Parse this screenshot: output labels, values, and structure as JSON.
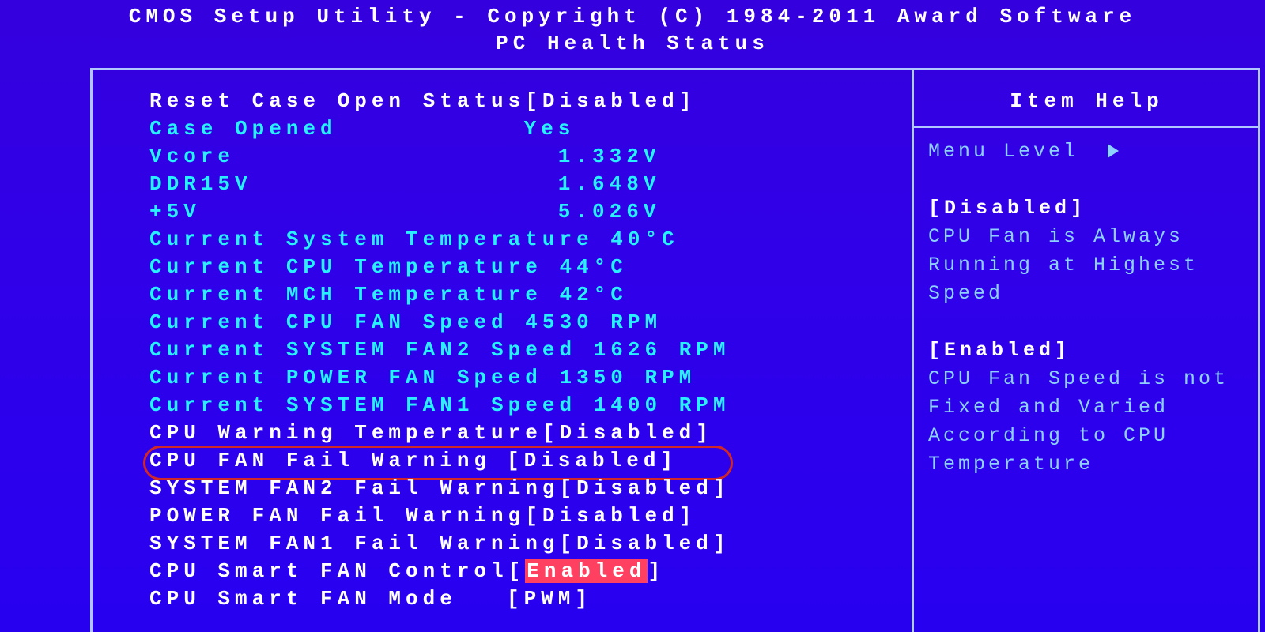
{
  "header": {
    "title": "CMOS Setup Utility - Copyright (C) 1984-2011 Award Software",
    "subtitle": "PC Health Status"
  },
  "rows": [
    {
      "label": "Reset Case Open Status",
      "value": "[Disabled]",
      "style": "white",
      "interactable": true
    },
    {
      "label": "Case Opened",
      "value": " Yes",
      "style": "cyan",
      "interactable": false
    },
    {
      "label": "Vcore",
      "value": "   1.332V",
      "style": "cyan",
      "interactable": false
    },
    {
      "label": "DDR15V",
      "value": "   1.648V",
      "style": "cyan",
      "interactable": false
    },
    {
      "label": "+5V",
      "value": "   5.026V",
      "style": "cyan",
      "interactable": false
    },
    {
      "label": "Current System Temperature",
      "value": " 40°C",
      "style": "cyan",
      "interactable": false
    },
    {
      "label": "Current CPU Temperature",
      "value": " 44°C",
      "style": "cyan",
      "interactable": false
    },
    {
      "label": "Current MCH Temperature",
      "value": " 42°C",
      "style": "cyan",
      "interactable": false
    },
    {
      "label": "Current CPU FAN Speed",
      "value": " 4530 RPM",
      "style": "cyan",
      "interactable": false
    },
    {
      "label": "Current SYSTEM FAN2 Speed",
      "value": " 1626 RPM",
      "style": "cyan",
      "interactable": false
    },
    {
      "label": "Current POWER FAN Speed",
      "value": " 1350 RPM",
      "style": "cyan",
      "interactable": false
    },
    {
      "label": "Current SYSTEM FAN1 Speed",
      "value": " 1400 RPM",
      "style": "cyan",
      "interactable": false
    },
    {
      "label": "CPU Warning Temperature",
      "value": "[Disabled]",
      "style": "white",
      "interactable": true
    },
    {
      "label": "CPU FAN Fail Warning",
      "value": "[Disabled]",
      "style": "white",
      "interactable": true,
      "circled": true
    },
    {
      "label": "SYSTEM FAN2 Fail Warning",
      "value": "[Disabled]",
      "style": "white",
      "interactable": true
    },
    {
      "label": "POWER FAN Fail Warning",
      "value": "[Disabled]",
      "style": "white",
      "interactable": true
    },
    {
      "label": "SYSTEM FAN1 Fail Warning",
      "value": "[Disabled]",
      "style": "white",
      "interactable": true
    },
    {
      "label": "CPU Smart FAN Control",
      "value_open": "[",
      "value_sel": "Enabled",
      "value_close": "]",
      "style": "white",
      "interactable": true,
      "selected": true
    },
    {
      "label": "CPU Smart FAN Mode",
      "value": "[PWM]",
      "style": "white",
      "interactable": true
    }
  ],
  "help": {
    "title": "Item Help",
    "menu_level": "Menu Level",
    "disabled_heading": "[Disabled]",
    "disabled_text": "CPU Fan is Always Running at Highest Speed",
    "enabled_heading": "[Enabled]",
    "enabled_text": "CPU Fan Speed is not Fixed and Varied According to CPU Temperature"
  }
}
